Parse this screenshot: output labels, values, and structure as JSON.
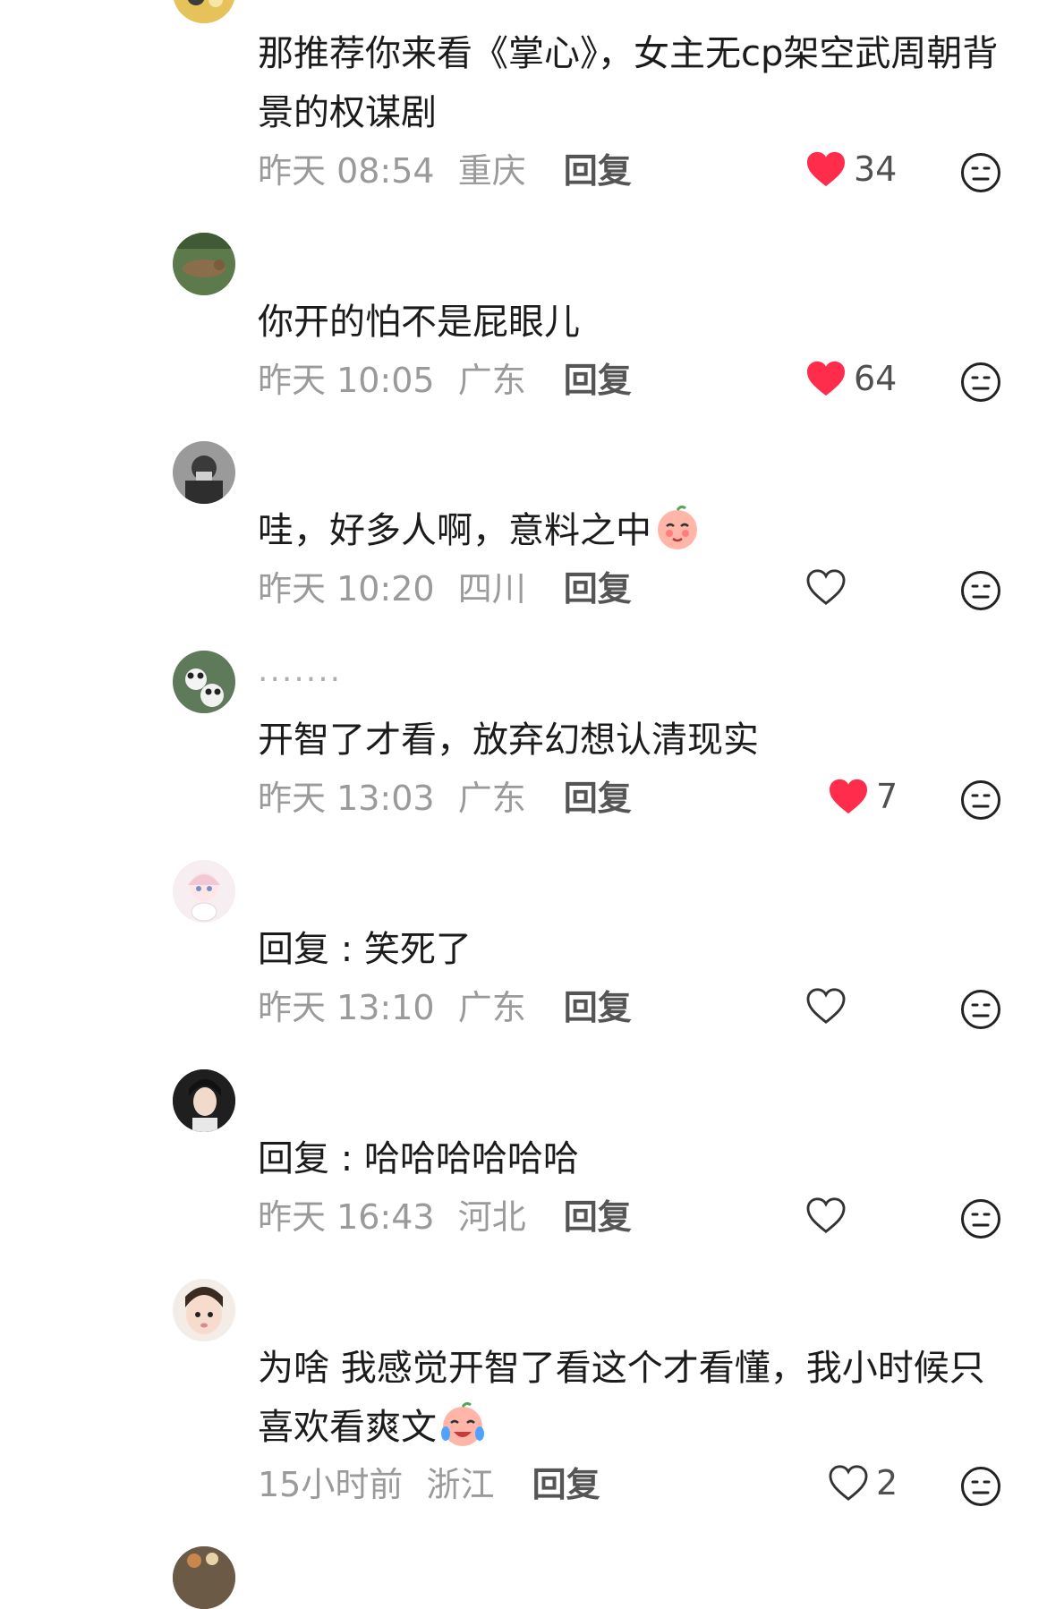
{
  "colors": {
    "liked_heart": "#ff2d4b",
    "meta_text": "#9a9a9a",
    "body_text": "#1b1b1b"
  },
  "top_partial": {
    "username": ""
  },
  "comments": [
    {
      "username": "",
      "text": "那推荐你来看《掌心》，女主无cp架空武周朝背景的权谋剧",
      "time": "昨天 08:54",
      "location": "重庆",
      "reply": "回复",
      "likes": "34",
      "liked": true
    },
    {
      "username": "",
      "text": "你开的怕不是屁眼儿",
      "time": "昨天 10:05",
      "location": "广东",
      "reply": "回复",
      "likes": "64",
      "liked": true
    },
    {
      "username": "",
      "text": "哇，好多人啊，意料之中",
      "emoji": "shy-face-emoji",
      "time": "昨天 10:20",
      "location": "四川",
      "reply": "回复",
      "likes": "",
      "liked": false
    },
    {
      "username": ".......",
      "text": "开智了才看，放弃幻想认清现实",
      "time": "昨天 13:03",
      "location": "广东",
      "reply": "回复",
      "likes": "7",
      "liked": true
    },
    {
      "username": "",
      "reply_prefix": "回复",
      "mention": "",
      "text": ": 笑死了",
      "time": "昨天 13:10",
      "location": "广东",
      "reply": "回复",
      "likes": "",
      "liked": false
    },
    {
      "username": "",
      "reply_prefix": "回复",
      "mention": "",
      "text": ": 哈哈哈哈哈哈",
      "time": "昨天 16:43",
      "location": "河北",
      "reply": "回复",
      "likes": "",
      "liked": false
    },
    {
      "username": "",
      "text": "为啥  我感觉开智了看这个才看懂，我小时候只喜欢看爽文",
      "emoji": "crying-laugh-emoji",
      "time": "15小时前",
      "location": "浙江",
      "reply": "回复",
      "likes": "2",
      "liked": false
    }
  ],
  "bottom_partial": {
    "username": ""
  }
}
